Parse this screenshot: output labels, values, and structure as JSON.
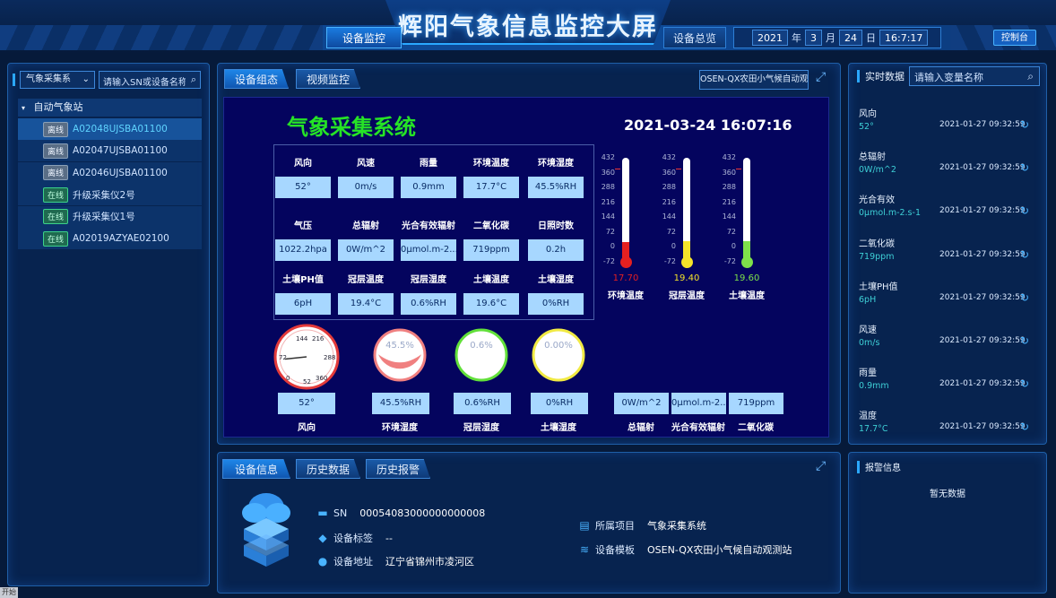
{
  "header": {
    "title": "辉阳气象信息监控大屏",
    "nav_left": "设备监控",
    "nav_right": "设备总览",
    "date": {
      "year": "2021",
      "year_unit": "年",
      "month": "3",
      "month_unit": "月",
      "day": "24",
      "day_unit": "日",
      "time": "16:7:17"
    },
    "control_label": "控制台"
  },
  "left": {
    "type_select": "气象采集系",
    "search_placeholder": "请输入SN或设备名称",
    "tree_root": "自动气象站",
    "devices": [
      {
        "status": "离线",
        "name": "A02048UJSBA01100",
        "online": false,
        "selected": true
      },
      {
        "status": "离线",
        "name": "A02047UJSBA01100",
        "online": false
      },
      {
        "status": "离线",
        "name": "A02046UJSBA01100",
        "online": false
      },
      {
        "status": "在线",
        "name": "升级采集仪2号",
        "online": true
      },
      {
        "status": "在线",
        "name": "升级采集仪1号",
        "online": true
      },
      {
        "status": "在线",
        "name": "A02019AZYAE02100",
        "online": true
      }
    ]
  },
  "center": {
    "tabs": [
      "设备组态",
      "视频监控"
    ],
    "model_label": "OSEN-QX农田小气候自动观",
    "screen_title": "气象采集系统",
    "screen_time": "2021-03-24 16:07:16",
    "grid": [
      [
        {
          "label": "风向",
          "value": "52°"
        },
        {
          "label": "风速",
          "value": "0m/s"
        },
        {
          "label": "雨量",
          "value": "0.9mm"
        },
        {
          "label": "环境温度",
          "value": "17.7°C"
        },
        {
          "label": "环境湿度",
          "value": "45.5%RH"
        }
      ],
      [
        {
          "label": "气压",
          "value": "1022.2hpa"
        },
        {
          "label": "总辐射",
          "value": "0W/m^2"
        },
        {
          "label": "光合有效辐射",
          "value": "0μmol.m-2..."
        },
        {
          "label": "二氧化碳",
          "value": "719ppm"
        },
        {
          "label": "日照时数",
          "value": "0.2h"
        }
      ],
      [
        {
          "label": "土壤PH值",
          "value": "6pH"
        },
        {
          "label": "冠层温度",
          "value": "19.4°C"
        },
        {
          "label": "冠层湿度",
          "value": "0.6%RH"
        },
        {
          "label": "土壤温度",
          "value": "19.6°C"
        },
        {
          "label": "土壤湿度",
          "value": "0%RH"
        }
      ]
    ],
    "therm_scale": [
      "432",
      "360",
      "288",
      "216",
      "144",
      "72",
      "0",
      "-72"
    ],
    "thermometers": [
      {
        "name": "环境温度",
        "value": "17.70",
        "level": 17.7,
        "color": "#e52020"
      },
      {
        "name": "冠层温度",
        "value": "19.40",
        "level": 19.4,
        "color": "#f4e42a"
      },
      {
        "name": "土壤温度",
        "value": "19.60",
        "level": 19.6,
        "color": "#7ee04a"
      }
    ],
    "dial": {
      "ticks": [
        "144",
        "216",
        "72",
        "288",
        "0",
        "52",
        "360"
      ],
      "value": "52°",
      "name": "风向",
      "angle": 52
    },
    "circles": [
      {
        "pct": "45.5%",
        "value": "45.5%RH",
        "name": "环境湿度",
        "color": "#f08080",
        "level": 0.455
      },
      {
        "pct": "0.6%",
        "value": "0.6%RH",
        "name": "冠层湿度",
        "color": "#62e03a",
        "level": 0.006
      },
      {
        "pct": "0.00%",
        "value": "0%RH",
        "name": "土壤湿度",
        "color": "#f1ea43",
        "level": 0
      }
    ],
    "bottom_vals": [
      {
        "value": "0W/m^2",
        "name": "总辐射"
      },
      {
        "value": "0μmol.m-2...",
        "name": "光合有效辐射"
      },
      {
        "value": "719ppm",
        "name": "二氧化碳"
      }
    ]
  },
  "info": {
    "tabs": [
      "设备信息",
      "历史数据",
      "历史报警"
    ],
    "sn_label": "SN",
    "sn_value": "00054083000000000008",
    "tag_label": "设备标签",
    "tag_value": "--",
    "addr_label": "设备地址",
    "addr_value": "辽宁省锦州市凌河区",
    "project_label": "所属项目",
    "project_value": "气象采集系统",
    "template_label": "设备模板",
    "template_value": "OSEN-QX农田小气候自动观测站"
  },
  "right": {
    "title": "实时数据",
    "search_placeholder": "请输入变量名称",
    "items": [
      {
        "name": "风向",
        "value": "52°",
        "time": "2021-01-27 09:32:59"
      },
      {
        "name": "总辐射",
        "value": "0W/m^2",
        "time": "2021-01-27 09:32:59"
      },
      {
        "name": "光合有效",
        "value": "0μmol.m-2.s-1",
        "time": "2021-01-27 09:32:59"
      },
      {
        "name": "二氧化碳",
        "value": "719ppm",
        "time": "2021-01-27 09:32:59"
      },
      {
        "name": "土壤PH值",
        "value": "6pH",
        "time": "2021-01-27 09:32:59"
      },
      {
        "name": "风速",
        "value": "0m/s",
        "time": "2021-01-27 09:32:59"
      },
      {
        "name": "雨量",
        "value": "0.9mm",
        "time": "2021-01-27 09:32:59"
      },
      {
        "name": "温度",
        "value": "17.7°C",
        "time": "2021-01-27 09:32:59"
      }
    ],
    "alarm_title": "报警信息",
    "alarm_empty": "暂无数据"
  },
  "taskbar": {
    "start": "开始"
  }
}
